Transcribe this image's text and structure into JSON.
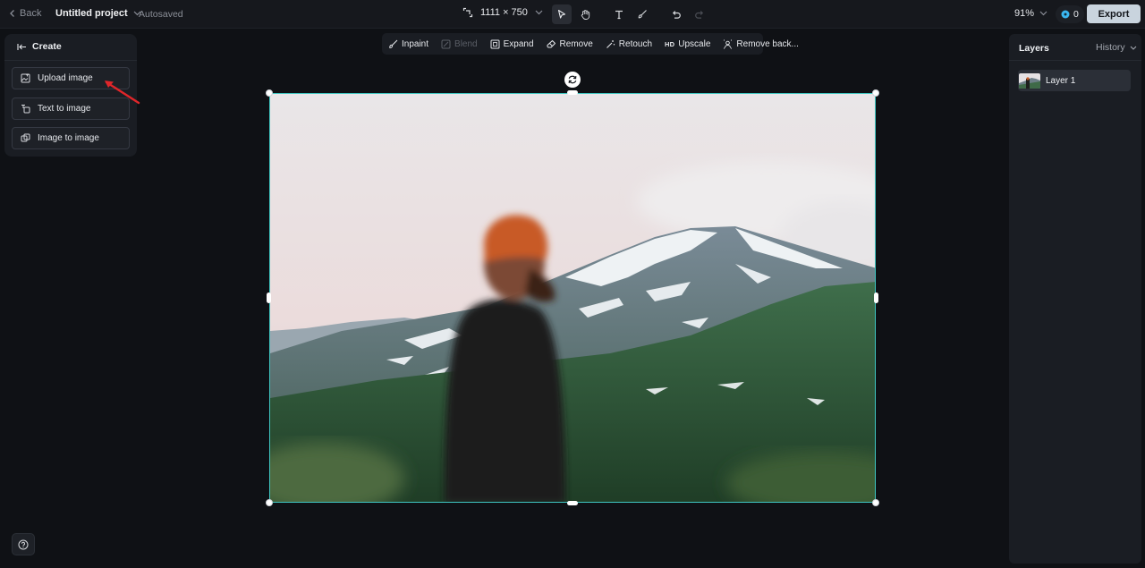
{
  "topbar": {
    "back_label": "Back",
    "project_name": "Untitled project",
    "autosaved": "Autosaved",
    "canvas_size": "1111 × 750",
    "zoom": "91%",
    "credits": "0",
    "export_label": "Export"
  },
  "create_panel": {
    "title": "Create",
    "items": [
      {
        "label": "Upload image",
        "icon": "upload-image-icon"
      },
      {
        "label": "Text to image",
        "icon": "text-to-image-icon"
      },
      {
        "label": "Image to image",
        "icon": "image-to-image-icon"
      }
    ]
  },
  "edit_toolbar": {
    "items": [
      {
        "label": "Inpaint",
        "icon": "inpaint-brush-icon",
        "enabled": true
      },
      {
        "label": "Blend",
        "icon": "blend-icon",
        "enabled": false
      },
      {
        "label": "Expand",
        "icon": "expand-icon",
        "enabled": true
      },
      {
        "label": "Remove",
        "icon": "eraser-icon",
        "enabled": true
      },
      {
        "label": "Retouch",
        "icon": "retouch-wand-icon",
        "enabled": true
      },
      {
        "label": "Upscale",
        "badge": "HD",
        "enabled": true
      },
      {
        "label": "Remove back...",
        "icon": "remove-background-icon",
        "enabled": true
      }
    ]
  },
  "layers_panel": {
    "tab_layers": "Layers",
    "tab_history": "History",
    "layers": [
      {
        "name": "Layer 1"
      }
    ]
  },
  "colors": {
    "accent_selection": "#3fc7c2",
    "credits_icon": "#3ab6f0",
    "annotation_arrow": "#e0262a"
  }
}
